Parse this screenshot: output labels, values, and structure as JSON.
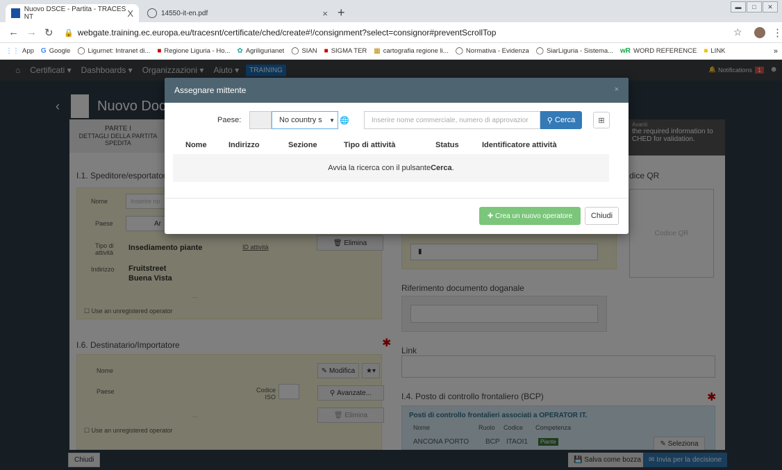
{
  "browser": {
    "tabs": [
      {
        "title": "Nuovo DSCE - Partita - TRACES NT",
        "close": "X"
      },
      {
        "title": "14550-it-en.pdf",
        "close": "×"
      }
    ],
    "new_tab": "+",
    "url": "webgate.training.ec.europa.eu/tracesnt/certificate/ched/create#!/consignment?select=consignor#preventScrollTop",
    "bookmarks": [
      "App",
      "Google",
      "Ligurnet: Intranet di...",
      "Regione Liguria - Ho...",
      "Agriligurianet",
      "SIAN",
      "SIGMA TER",
      "cartografia regione li...",
      "Normativa - Evidenza",
      "SiarLiguria - Sistema...",
      "WORD REFERENCE",
      "LINK"
    ]
  },
  "appnav": {
    "items": [
      "Certificati",
      "Dashboards",
      "Organizzazioni",
      "Aiuto"
    ],
    "training": "TRAINING",
    "notifications": "Notifications",
    "notif_count": "1"
  },
  "page": {
    "title": "Nuovo Doc",
    "parte": "PARTE I",
    "parte_sub": "DETTAGLI DELLA PARTITA SPEDITA",
    "avanti": "Avanti",
    "avanti_text": "the required information to CHED for validation.",
    "sec_i1": "I.1. Speditore/esportator",
    "nome_label": "Nome",
    "nome_placeholder": "Inserire no",
    "paese_label": "Paese",
    "paese_val": "Ar",
    "tipo_label": "Tipo di attività",
    "tipo_val": "Insediamento piante",
    "id_attivita": "ID attività",
    "elimina": "Elimina",
    "indirizzo_label": "Indirizzo",
    "indirizzo_1": "Fruitstreet",
    "indirizzo_2": "Buena Vista",
    "dots": "...",
    "unregistered": "Use an unregistered operator",
    "codice_qr_title": "dice QR",
    "codice_qr": "Codice QR",
    "rif_doganale": "Riferimento documento doganale",
    "sec_i6": "I.6. Destinatario/Importatore",
    "nome2": "Nome",
    "paese2": "Paese",
    "codice_iso": "Codice ISO",
    "modifica": "Modifica",
    "avanzate": "Avanzate...",
    "elimina2": "Elimina",
    "unregistered2": "Use an unregistered operator",
    "link": "Link",
    "sec_i4": "I.4. Posto di controllo frontaliero (BCP)",
    "bcp_info": "Posti di controllo frontalieri associati a OPERATOR IT.",
    "bcp_headers": [
      "Nome",
      "Ruolo",
      "Codice",
      "Competenza"
    ],
    "bcp_row": [
      "ANCONA PORTO",
      "BCP",
      "ITAOI1",
      "Piante"
    ],
    "seleziona": "Seleziona"
  },
  "footer": {
    "chiudi": "Chiudi",
    "salva": "Salva come bozza",
    "invia": "Invia per la decisione"
  },
  "modal": {
    "title": "Assegnare mittente",
    "close": "×",
    "paese_label": "Paese:",
    "country_select": "No country s",
    "search_placeholder": "Inserire nome commerciale, numero di approvazior",
    "cerca": "Cerca",
    "columns": [
      "Nome",
      "Indirizzo",
      "Sezione",
      "Tipo di attività",
      "Status",
      "Identificatore attività"
    ],
    "empty_prefix": "Avvia la ricerca con il pulsante ",
    "empty_bold": "Cerca",
    "empty_suffix": ".",
    "crea": "Crea un nuovo operatore",
    "chiudi": "Chiudi"
  },
  "colors": {
    "modal_header": "#4e6470",
    "primary": "#337ab7",
    "success_light": "#7bc67b",
    "app_nav": "#3c4145"
  }
}
